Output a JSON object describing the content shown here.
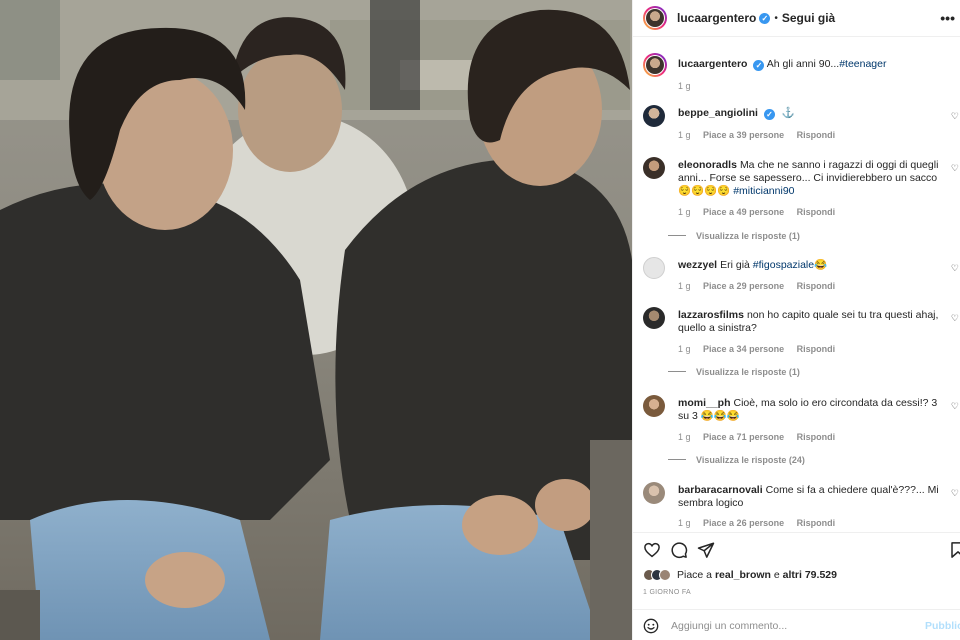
{
  "post": {
    "author": "lucaargentero",
    "follow_state": "Segui già",
    "separator": "•",
    "caption_text": "Ah gli anni 90...",
    "caption_hashtag": "#teenager",
    "caption_time": "1 g",
    "more_symbol": "•••"
  },
  "comments": [
    {
      "user": "beppe_angiolini",
      "verified": true,
      "pre": "",
      "text": "",
      "hashtag": "",
      "post": "",
      "extra_icon": "⚓",
      "time": "1 g",
      "likes": "Piace a 39 persone",
      "reply": "Rispondi",
      "replies": ""
    },
    {
      "user": "eleonoradls",
      "verified": false,
      "pre": "",
      "text": "Ma che ne sanno i ragazzi di oggi di quegli anni... Forse se sapessero... Ci invidierebbero un sacco😌😌😌😌 ",
      "hashtag": "#miticianni90",
      "post": "",
      "time": "1 g",
      "likes": "Piace a 49 persone",
      "reply": "Rispondi",
      "replies": "Visualizza le risposte (1)"
    },
    {
      "user": "wezzyel",
      "verified": false,
      "pre": "",
      "text": "Eri già ",
      "hashtag": "#figospaziale",
      "post": "😂",
      "time": "1 g",
      "likes": "Piace a 29 persone",
      "reply": "Rispondi",
      "replies": ""
    },
    {
      "user": "lazzarosfilms",
      "verified": false,
      "pre": "",
      "text": "non ho capito quale sei tu tra questi ahaj, quello a sinistra?",
      "hashtag": "",
      "post": "",
      "time": "1 g",
      "likes": "Piace a 34 persone",
      "reply": "Rispondi",
      "replies": "Visualizza le risposte (1)"
    },
    {
      "user": "momi__ph",
      "verified": false,
      "pre": "",
      "text": "Cioè, ma solo io ero circondata da cessi!? 3 su 3 😂😂😂",
      "hashtag": "",
      "post": "",
      "time": "1 g",
      "likes": "Piace a 71 persone",
      "reply": "Rispondi",
      "replies": "Visualizza le risposte (24)"
    },
    {
      "user": "barbaracarnovali",
      "verified": false,
      "pre": "",
      "text": "Come si fa a chiedere qual'è???... Mi sembra logico",
      "hashtag": "",
      "post": "",
      "time": "1 g",
      "likes": "Piace a 26 persone",
      "reply": "Rispondi",
      "replies": ""
    }
  ],
  "actions": {
    "like_icon": "heart-icon",
    "comment_icon": "comment-icon",
    "share_icon": "share-icon",
    "save_icon": "bookmark-icon",
    "likes_prefix": "Piace a ",
    "likes_user": "real_brown",
    "likes_mid": " e ",
    "likes_rest": "altri 79.529",
    "time_ago": "1 GIORNO FA"
  },
  "add_comment": {
    "placeholder": "Aggiungi un commento...",
    "publish": "Pubblica"
  },
  "colors": {
    "link": "#00376b",
    "verified": "#3897f0",
    "muted": "#8e8e8e",
    "publish_disabled": "#b2dffc"
  }
}
